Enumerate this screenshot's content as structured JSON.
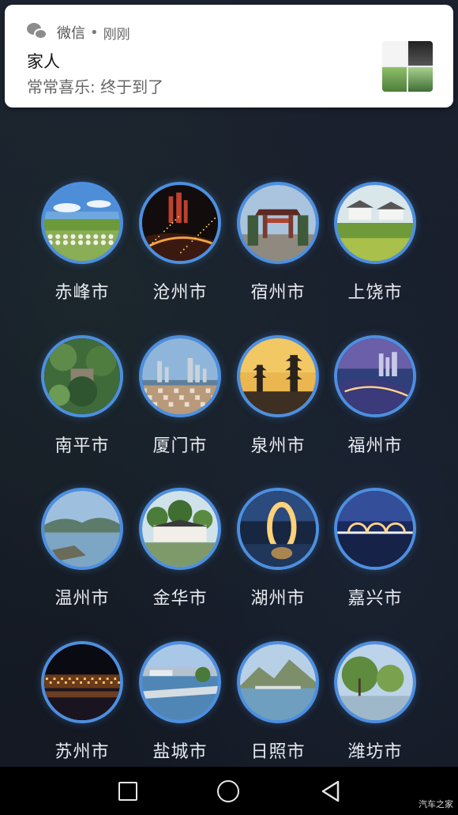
{
  "notification": {
    "app_name": "微信",
    "separator": "•",
    "time": "刚刚",
    "title": "家人",
    "message": "常常喜乐: 终于到了"
  },
  "cities": [
    {
      "name": "赤峰市",
      "scene": "grassland"
    },
    {
      "name": "沧州市",
      "scene": "night-city"
    },
    {
      "name": "宿州市",
      "scene": "gate"
    },
    {
      "name": "上饶市",
      "scene": "village"
    },
    {
      "name": "南平市",
      "scene": "garden"
    },
    {
      "name": "厦门市",
      "scene": "skyline"
    },
    {
      "name": "泉州市",
      "scene": "pagoda"
    },
    {
      "name": "福州市",
      "scene": "river-dusk"
    },
    {
      "name": "温州市",
      "scene": "lake"
    },
    {
      "name": "金华市",
      "scene": "ancient-village"
    },
    {
      "name": "湖州市",
      "scene": "moon-hotel"
    },
    {
      "name": "嘉兴市",
      "scene": "bridge"
    },
    {
      "name": "苏州市",
      "scene": "night-waterfront"
    },
    {
      "name": "盐城市",
      "scene": "riverside"
    },
    {
      "name": "日照市",
      "scene": "mountain-lake"
    },
    {
      "name": "潍坊市",
      "scene": "willow"
    }
  ],
  "navbar": {
    "recent": "square-icon",
    "home": "circle-icon",
    "back": "triangle-back-icon"
  },
  "watermark": "汽车之家",
  "colors": {
    "ring": "#4d8fe0",
    "background": "#1a1f2b"
  }
}
